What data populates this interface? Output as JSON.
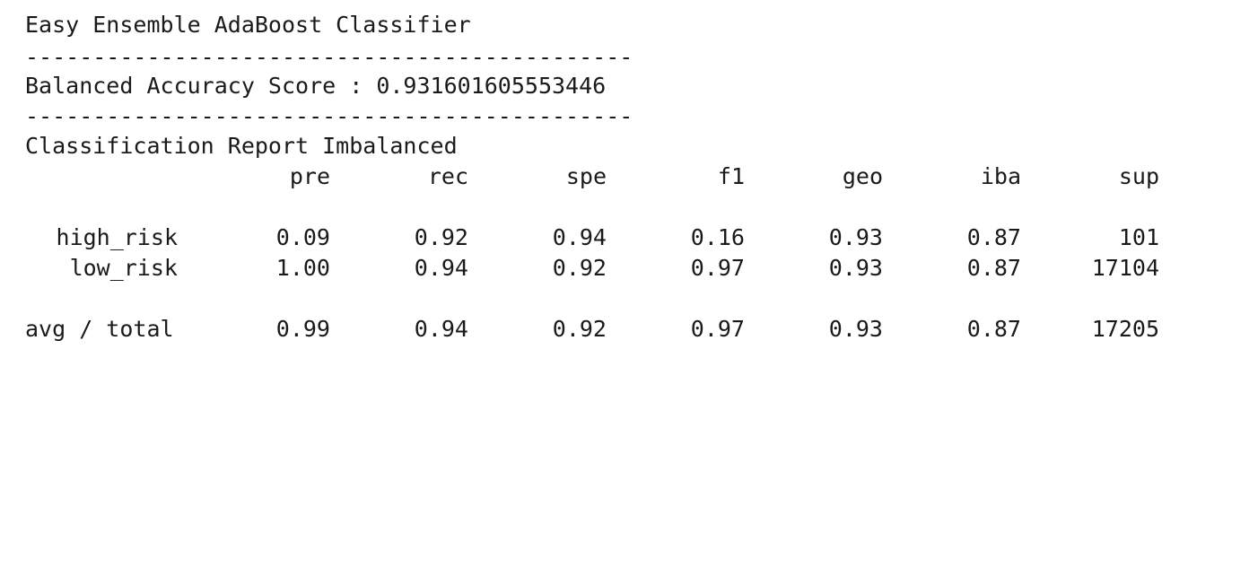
{
  "output": {
    "title": "Easy Ensemble AdaBoost Classifier",
    "separator": "---------------------------------------------",
    "balanced_accuracy_label": "Balanced Accuracy Score : 0.931601605553446",
    "report_title": "Classification Report Imbalanced",
    "report": {
      "columns": [
        "pre",
        "rec",
        "spe",
        "f1",
        "geo",
        "iba",
        "sup"
      ],
      "rows": [
        {
          "label": "high_risk",
          "values": [
            "0.09",
            "0.92",
            "0.94",
            "0.16",
            "0.93",
            "0.87",
            "101"
          ]
        },
        {
          "label": "low_risk",
          "values": [
            "1.00",
            "0.94",
            "0.92",
            "0.97",
            "0.93",
            "0.87",
            "17104"
          ]
        }
      ],
      "avg": {
        "label": "avg / total",
        "values": [
          "0.99",
          "0.94",
          "0.92",
          "0.97",
          "0.93",
          "0.87",
          "17205"
        ]
      }
    }
  }
}
